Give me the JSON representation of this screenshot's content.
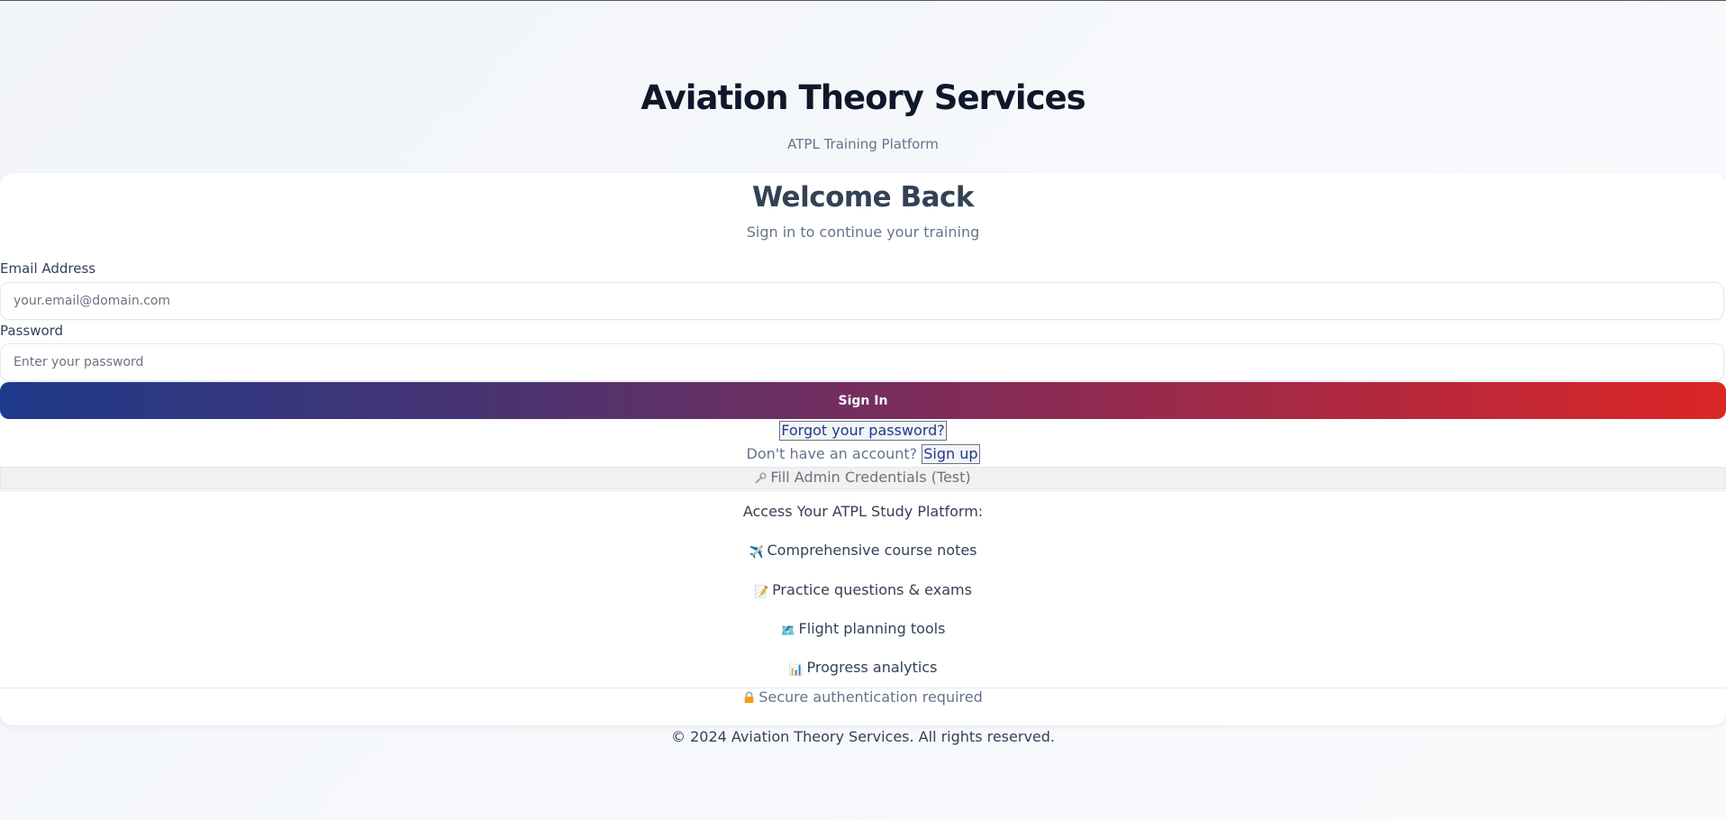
{
  "header": {
    "title": "Aviation Theory Services",
    "subtitle": "ATPL Training Platform"
  },
  "card": {
    "title": "Welcome Back",
    "subtitle": "Sign in to continue your training",
    "email": {
      "label": "Email Address",
      "placeholder": "your.email@domain.com",
      "value": ""
    },
    "password": {
      "label": "Password",
      "placeholder": "Enter your password",
      "value": ""
    },
    "signin_label": "Sign In",
    "forgot_label": "Forgot your password?",
    "signup_prompt": "Don't have an account?",
    "signup_label": "Sign up",
    "admin_fill_label": "Fill Admin Credentials (Test)",
    "admin_fill_icon": "wrench-icon",
    "features": {
      "heading": "Access Your ATPL Study Platform:",
      "items": [
        {
          "icon": "airplane-icon",
          "glyph": "✈️",
          "label": "Comprehensive course notes"
        },
        {
          "icon": "memo-icon",
          "glyph": "📝",
          "label": "Practice questions & exams"
        },
        {
          "icon": "map-icon",
          "glyph": "🗺️",
          "label": "Flight planning tools"
        },
        {
          "icon": "bar-chart-icon",
          "glyph": "📊",
          "label": "Progress analytics"
        }
      ]
    },
    "secure_note": "Secure authentication required",
    "secure_icon": "lock-icon"
  },
  "footer": {
    "text": "© 2024 Aviation Theory Services. All rights reserved."
  },
  "colors": {
    "brand_blue": "#1e3a8a",
    "brand_red": "#dc2626",
    "title_dark": "#0f172a",
    "muted": "#64748b"
  }
}
